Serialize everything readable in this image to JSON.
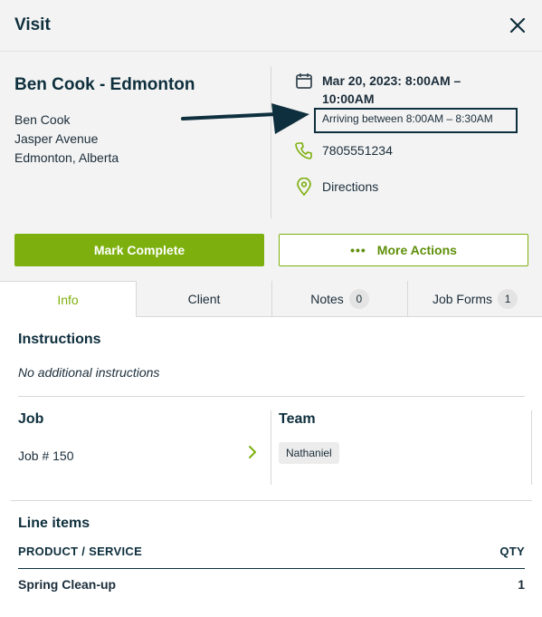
{
  "header": {
    "title": "Visit"
  },
  "client": {
    "title": "Ben Cook - Edmonton",
    "name": "Ben Cook",
    "street": "Jasper Avenue",
    "city": "Edmonton, Alberta"
  },
  "visit": {
    "date_line1": "Mar 20, 2023: 8:00AM –",
    "date_line2": "10:00AM",
    "arrival": "Arriving between 8:00AM – 8:30AM",
    "phone": "7805551234",
    "directions": "Directions"
  },
  "actions": {
    "complete": "Mark Complete",
    "more_dots": "•••",
    "more": "More Actions"
  },
  "tabs": [
    {
      "label": "Info"
    },
    {
      "label": "Client"
    },
    {
      "label": "Notes",
      "badge": "0"
    },
    {
      "label": "Job Forms",
      "badge": "1"
    }
  ],
  "instructions": {
    "title": "Instructions",
    "text": "No additional instructions"
  },
  "job": {
    "title": "Job",
    "link": "Job # 150"
  },
  "team": {
    "title": "Team",
    "member": "Nathaniel"
  },
  "line_items": {
    "title": "Line items",
    "col_product": "PRODUCT / SERVICE",
    "col_qty": "QTY",
    "items": [
      {
        "name": "Spring Clean-up",
        "qty": "1"
      }
    ]
  },
  "colors": {
    "accent": "#7db00e",
    "text": "#0e2f3d",
    "panel": "#f3f3f3"
  }
}
